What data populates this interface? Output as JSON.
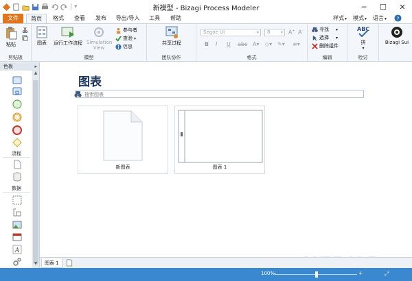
{
  "window": {
    "title": "新模型 - Bizagi Process Modeler"
  },
  "quick_access": [
    "save-icon",
    "open-icon",
    "save-alt-icon",
    "print-icon",
    "undo-icon",
    "redo-icon"
  ],
  "tabs": {
    "file": "文件",
    "home": "首页",
    "format": "格式",
    "view": "查看",
    "publish": "发布",
    "import_export": "导出/导入",
    "tools": "工具",
    "help": "帮助"
  },
  "right_menus": {
    "style": "样式",
    "mode": "模式",
    "language": "语言"
  },
  "ribbon": {
    "clipboard": {
      "paste": "粘贴",
      "label": "剪贴板"
    },
    "model": {
      "diagram": "图表",
      "run_workflow": "运行工作流程",
      "simulation": "Simulation View",
      "participants": "参与者",
      "check": "查验",
      "info": "信息",
      "label": "模型"
    },
    "team": {
      "share": "共享过程",
      "label": "团队协作"
    },
    "format": {
      "font": "Segoe UI",
      "size": "8",
      "label": "格式"
    },
    "edit": {
      "find": "寻找",
      "select": "选择",
      "delete_component": "删除组件",
      "label": "编辑"
    },
    "check": {
      "spell": "拼",
      "label": "检讨"
    },
    "bizagi": {
      "label": "Bizagi Sui"
    }
  },
  "left_panel": {
    "title": "色板",
    "categories": {
      "flow": "流程",
      "data": "数据"
    }
  },
  "main": {
    "heading": "图表",
    "search_placeholder": "搜索图表",
    "cards": [
      {
        "caption": "新图表"
      },
      {
        "caption": "图表 1"
      }
    ]
  },
  "bottom_tab": {
    "label": "图表 1"
  },
  "status": {
    "zoom": "100%"
  },
  "watermark": "UEBUG"
}
